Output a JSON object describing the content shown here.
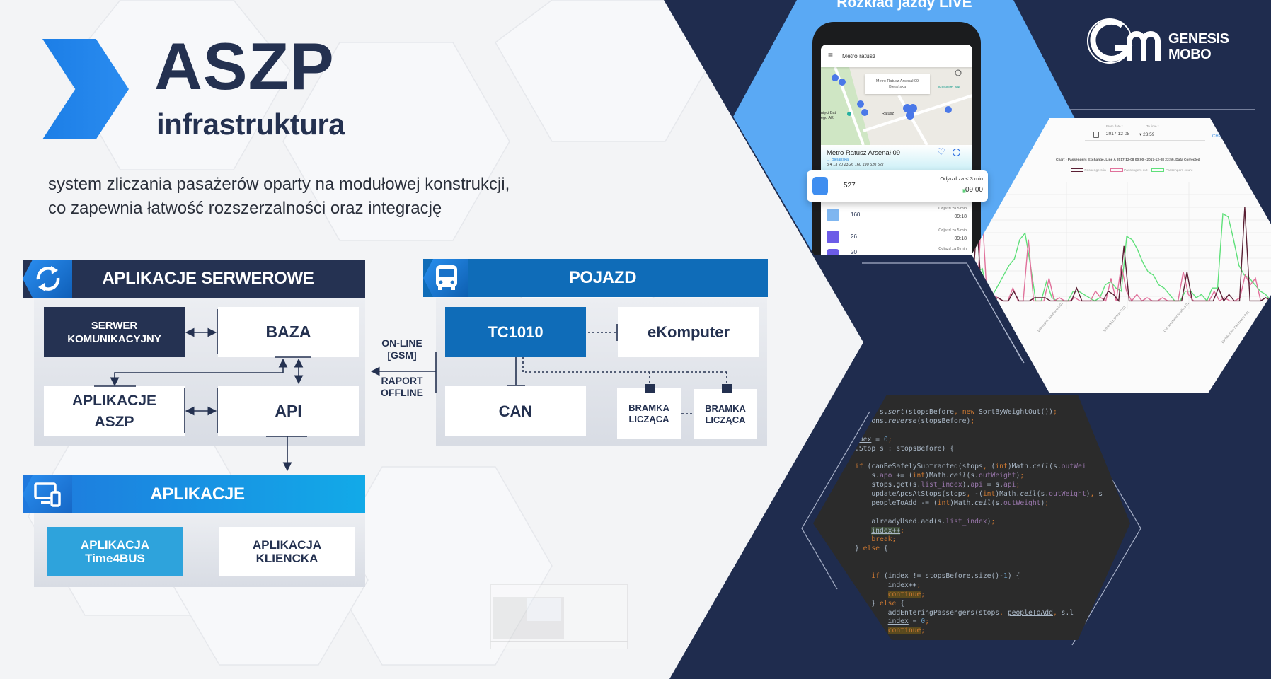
{
  "header": {
    "title": "ASZP",
    "subtitle": "infrastruktura",
    "description_lines": [
      "system zliczania pasażerów oparty na modułowej konstrukcji,",
      "co zapewnia łatwość rozszerzalności oraz integrację"
    ]
  },
  "colors": {
    "navy": "#1f2c4e",
    "dark_text": "#243150",
    "accent_blue": "#0f6cb8",
    "light_blue": "#2ea3dc",
    "hex_blue": "#5aa9f4"
  },
  "server_panel": {
    "title": "APLIKACJE SERWEROWE",
    "icon": "sync-icon",
    "boxes": {
      "comm_server": [
        "SERWER",
        "KOMUNIKACYJNY"
      ],
      "db": "BAZA",
      "apps": [
        "APLIKACJE",
        "ASZP"
      ],
      "api": "API"
    }
  },
  "vehicle_panel": {
    "title": "POJAZD",
    "icon": "bus-icon",
    "boxes": {
      "controller": "TC1010",
      "computer": "eKomputer",
      "can": "CAN",
      "gate1": [
        "BRAMKA",
        "LICZĄCA"
      ],
      "gate2": [
        "BRAMKA",
        "LICZĄCA"
      ]
    }
  },
  "link_labels": {
    "online": [
      "ON-LINE",
      "[GSM]"
    ],
    "offline": [
      "RAPORT",
      "OFFLINE"
    ]
  },
  "apps_panel": {
    "title": "APLIKACJE",
    "icon": "devices-icon",
    "boxes": {
      "time4bus": [
        "APLIKACJA",
        "Time4BUS"
      ],
      "client": [
        "APLIKACJA",
        "KLIENCKA"
      ]
    }
  },
  "phone_showcase": {
    "title": "Rozkład jazdy LIVE",
    "search": "Metro ratusz",
    "map_popup": [
      "Metro Ratusz Arsenał 09",
      "Bielańska"
    ],
    "map_poi": "Muzeum Nie",
    "map_labels": [
      "Ratusz",
      "nięci Bat",
      "ego AK"
    ],
    "stop_name": "Metro Ratusz Arsenał 09",
    "direction": "→  Bielańska",
    "lines": "3 4 13 20 23 26 160 190 520 527",
    "departures": [
      {
        "line": "527",
        "info": "Odjazd za < 3 min",
        "time": "09:00"
      },
      {
        "line": "160",
        "info": "Odjazd za 5 min",
        "time": "09:18"
      },
      {
        "line": "26",
        "info": "Odjazd za 5 min",
        "time": "09:18"
      },
      {
        "line": "20",
        "info": "Odjazd za 6 min",
        "time": ""
      }
    ]
  },
  "chart_showcase": {
    "from_label": "From date *",
    "from_value": "2017-12-08",
    "to_label": "To time *",
    "to_value": "23:59",
    "action": "CHA",
    "title": "Chart - Passengers Exchange, Line A 2017-12-08 00:00 - 2017-12-08 23:59, Data Corrected",
    "legend": [
      "Passengers in",
      "Passengers out",
      "Passengers count"
    ],
    "series_colors": [
      "#5a1f33",
      "#e0719b",
      "#5fe07a"
    ],
    "x_labels": [
      "Wittelsdorf, Gasthaus 0.01",
      "Schönfeld, Schule 0.01",
      "Cunnersdorfer Straße 0.01",
      "Eschdorf Am Steinbruch 0.02"
    ],
    "series": {
      "in": [
        1,
        25,
        1,
        3,
        1,
        2,
        1,
        1,
        4,
        1,
        1,
        1,
        2,
        2,
        2,
        1,
        1,
        1,
        1,
        1,
        5,
        1,
        1,
        1,
        1,
        1,
        4,
        3,
        1,
        18,
        1,
        1,
        1,
        1,
        1,
        1,
        1,
        1,
        1,
        1,
        1,
        10,
        1,
        1,
        1,
        1,
        1,
        5,
        1,
        3,
        1,
        1,
        30,
        1,
        1,
        1,
        2,
        1
      ],
      "out": [
        1,
        1,
        30,
        1,
        3,
        2,
        1,
        1,
        5,
        1,
        1,
        20,
        1,
        1,
        1,
        8,
        1,
        2,
        1,
        1,
        2,
        1,
        1,
        1,
        4,
        2,
        1,
        8,
        1,
        12,
        4,
        1,
        3,
        1,
        2,
        1,
        1,
        2,
        1,
        1,
        1,
        10,
        3,
        1,
        1,
        1,
        1,
        4,
        1,
        2,
        1,
        1,
        2,
        9,
        6,
        8,
        1,
        2,
        1
      ],
      "count": [
        9,
        10,
        11,
        2,
        3,
        6,
        9,
        12,
        14,
        20,
        22,
        12,
        1,
        1,
        7,
        2,
        1,
        1,
        1,
        4,
        4,
        3,
        2,
        1,
        2,
        6,
        7,
        5,
        4,
        21,
        20,
        17,
        13,
        10,
        9,
        6,
        5,
        3,
        1,
        1,
        4,
        4,
        2,
        3,
        1,
        5,
        5,
        28,
        27,
        20,
        12,
        9,
        8,
        6,
        4,
        3,
        1
      ]
    }
  },
  "code_showcase": {
    "lines": [
      [
        [
          "      s.",
          "p"
        ],
        [
          "sort",
          "m"
        ],
        [
          "(stopsBefore",
          "p"
        ],
        [
          ", ",
          "k"
        ],
        [
          "new ",
          "k"
        ],
        [
          "SortByWeightOut())",
          "p"
        ],
        [
          ";",
          "k"
        ]
      ],
      [
        [
          "    ons.",
          "p"
        ],
        [
          "reverse",
          "m"
        ],
        [
          "(stopsBefore)",
          "p"
        ],
        [
          ";",
          "k"
        ]
      ],
      [],
      [
        [
          " ",
          "p"
        ],
        [
          "dex",
          "u"
        ],
        [
          " = ",
          "p"
        ],
        [
          "0",
          "n"
        ],
        [
          ";",
          "k"
        ]
      ],
      [
        [
          ".Stop s : stopsBefore) {",
          "p"
        ]
      ],
      [],
      [
        [
          "if ",
          "k"
        ],
        [
          "(canBeSafelySubtracted(stops",
          "p"
        ],
        [
          ", ",
          "k"
        ],
        [
          "(",
          "p"
        ],
        [
          "int",
          "k"
        ],
        [
          ")Math.",
          "p"
        ],
        [
          "ceil",
          "m"
        ],
        [
          "(s.",
          "p"
        ],
        [
          "outWei",
          "f"
        ]
      ],
      [
        [
          "    s.",
          "p"
        ],
        [
          "apo",
          "f"
        ],
        [
          " += (",
          "p"
        ],
        [
          "int",
          "k"
        ],
        [
          ")Math.",
          "p"
        ],
        [
          "ceil",
          "m"
        ],
        [
          "(s.",
          "p"
        ],
        [
          "outWeight",
          "f"
        ],
        [
          ")",
          "p"
        ],
        [
          ";",
          "k"
        ]
      ],
      [
        [
          "    stops.get(s.",
          "p"
        ],
        [
          "list_index",
          "f"
        ],
        [
          ").",
          "p"
        ],
        [
          "api",
          "f"
        ],
        [
          " = s.",
          "p"
        ],
        [
          "api",
          "f"
        ],
        [
          ";",
          "k"
        ]
      ],
      [
        [
          "    updateApcsAtStops(stops",
          "p"
        ],
        [
          ", ",
          "k"
        ],
        [
          "-(",
          "p"
        ],
        [
          "int",
          "k"
        ],
        [
          ")Math.",
          "p"
        ],
        [
          "ceil",
          "m"
        ],
        [
          "(s.",
          "p"
        ],
        [
          "outWeight",
          "f"
        ],
        [
          ")",
          "p"
        ],
        [
          ", ",
          "k"
        ],
        [
          "s",
          "p"
        ]
      ],
      [
        [
          "    ",
          "p"
        ],
        [
          "peopleToAdd",
          "u"
        ],
        [
          " -= (",
          "p"
        ],
        [
          "int",
          "k"
        ],
        [
          ")Math.",
          "p"
        ],
        [
          "ceil",
          "m"
        ],
        [
          "(s.",
          "p"
        ],
        [
          "outWeight",
          "f"
        ],
        [
          ")",
          "p"
        ],
        [
          ";",
          "k"
        ]
      ],
      [],
      [
        [
          "    alreadyUsed.add(s.",
          "p"
        ],
        [
          "list_index",
          "f"
        ],
        [
          ")",
          "p"
        ],
        [
          ";",
          "k"
        ]
      ],
      [
        [
          "    ",
          "p"
        ],
        [
          "index++",
          "h"
        ],
        [
          ";",
          "k"
        ]
      ],
      [
        [
          "    ",
          "p"
        ],
        [
          "break;",
          "k"
        ]
      ],
      [
        [
          "} ",
          "p"
        ],
        [
          "else ",
          "k"
        ],
        [
          "{",
          "p"
        ]
      ],
      [],
      [],
      [
        [
          "    ",
          "p"
        ],
        [
          "if ",
          "k"
        ],
        [
          "(",
          "p"
        ],
        [
          "index",
          "u"
        ],
        [
          " != stopsBefore.size()-",
          "p"
        ],
        [
          "1",
          "n"
        ],
        [
          ") {",
          "p"
        ]
      ],
      [
        [
          "        ",
          "p"
        ],
        [
          "index",
          "u"
        ],
        [
          "++",
          "p"
        ],
        [
          ";",
          "k"
        ]
      ],
      [
        [
          "        ",
          "p"
        ],
        [
          "continue",
          "h2"
        ],
        [
          ";",
          "k"
        ]
      ],
      [
        [
          "    } ",
          "p"
        ],
        [
          "else ",
          "k"
        ],
        [
          "{",
          "p"
        ]
      ],
      [
        [
          "        addEnteringPassengers(stops",
          "p"
        ],
        [
          ", ",
          "k"
        ],
        [
          "peopleToAdd",
          "u"
        ],
        [
          ", ",
          "k"
        ],
        [
          "s.l",
          "p"
        ]
      ],
      [
        [
          "        ",
          "p"
        ],
        [
          "index",
          "u"
        ],
        [
          " = ",
          "p"
        ],
        [
          "0",
          "n"
        ],
        [
          ";",
          "k"
        ]
      ],
      [
        [
          "        ",
          "p"
        ],
        [
          "continue",
          "h2"
        ],
        [
          ";",
          "k"
        ]
      ]
    ]
  },
  "logo": {
    "line1": "GENESIS",
    "line2": "MOBO"
  }
}
